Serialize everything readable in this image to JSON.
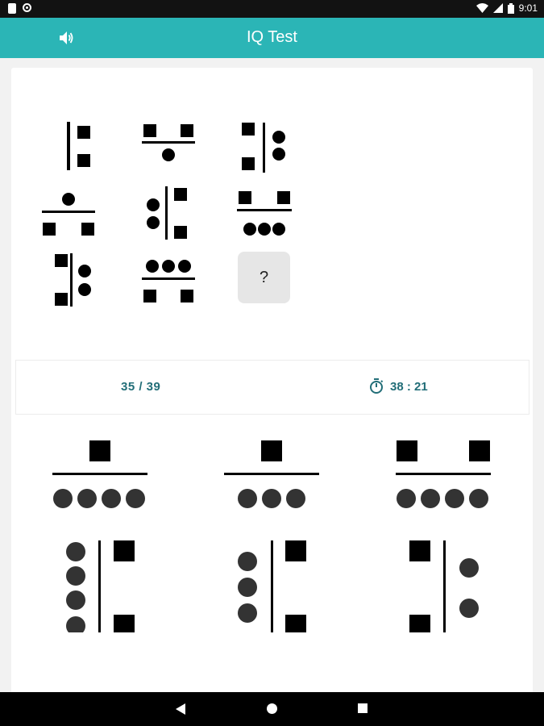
{
  "status_bar": {
    "time": "9:01",
    "icons": [
      "file-icon",
      "sync-circle-icon",
      "wifi-icon",
      "signal-icon",
      "battery-icon"
    ]
  },
  "app_bar": {
    "title": "IQ Test",
    "sound_icon": "speaker-icon"
  },
  "question": {
    "placeholder": "?"
  },
  "info": {
    "progress": "35 / 39",
    "timer": "38 : 21",
    "timer_icon": "stopwatch-icon"
  },
  "nav": {
    "icons": [
      "back-icon",
      "home-icon",
      "recents-icon"
    ]
  },
  "colors": {
    "teal": "#2bb5b6",
    "info_text": "#226e78",
    "option_circle": "#333333"
  }
}
